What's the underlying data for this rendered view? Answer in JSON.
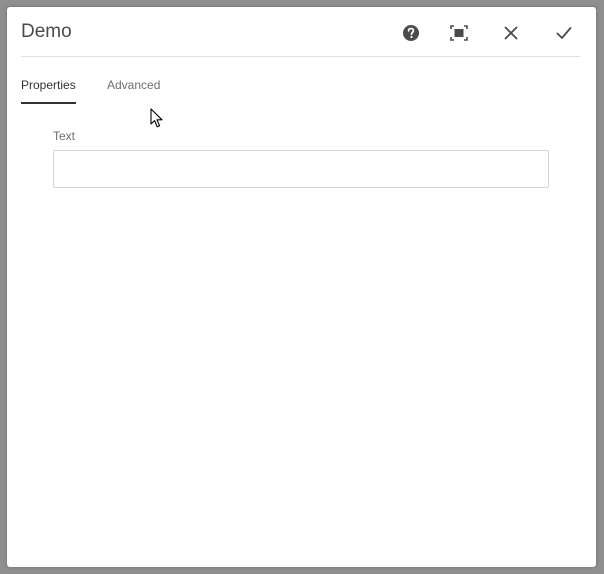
{
  "dialog": {
    "title": "Demo",
    "actions": {
      "help": "help-icon",
      "fullscreen": "fullscreen-icon",
      "close": "close-icon",
      "done": "checkmark-icon"
    }
  },
  "tabs": [
    {
      "label": "Properties",
      "active": true
    },
    {
      "label": "Advanced",
      "active": false
    }
  ],
  "form": {
    "text_field": {
      "label": "Text",
      "value": "",
      "placeholder": ""
    }
  },
  "colors": {
    "text_primary": "#323232",
    "text_secondary": "#6e6e6e",
    "backdrop": "#9e9e9e",
    "surface": "#ffffff",
    "border": "#d3d3d3"
  }
}
